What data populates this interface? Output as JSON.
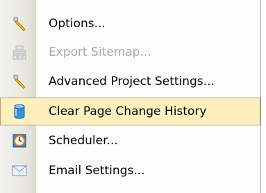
{
  "menu": {
    "items": [
      {
        "label": "Options...",
        "icon": "wrench-icon",
        "enabled": true,
        "selected": false
      },
      {
        "label": "Export Sitemap...",
        "icon": "export-sitemap-icon",
        "enabled": false,
        "selected": false
      },
      {
        "label": "Advanced Project Settings...",
        "icon": "wrench-icon",
        "enabled": true,
        "selected": false
      },
      {
        "label": "Clear Page Change History",
        "icon": "database-icon",
        "enabled": true,
        "selected": true
      },
      {
        "label": "Scheduler...",
        "icon": "clock-icon",
        "enabled": true,
        "selected": false
      },
      {
        "label": "Email Settings...",
        "icon": "envelope-icon",
        "enabled": true,
        "selected": false
      }
    ]
  },
  "colors": {
    "highlight_background": "#fdf0be",
    "highlight_border": "#b3a06a",
    "disabled_text": "#a8a8a8"
  }
}
